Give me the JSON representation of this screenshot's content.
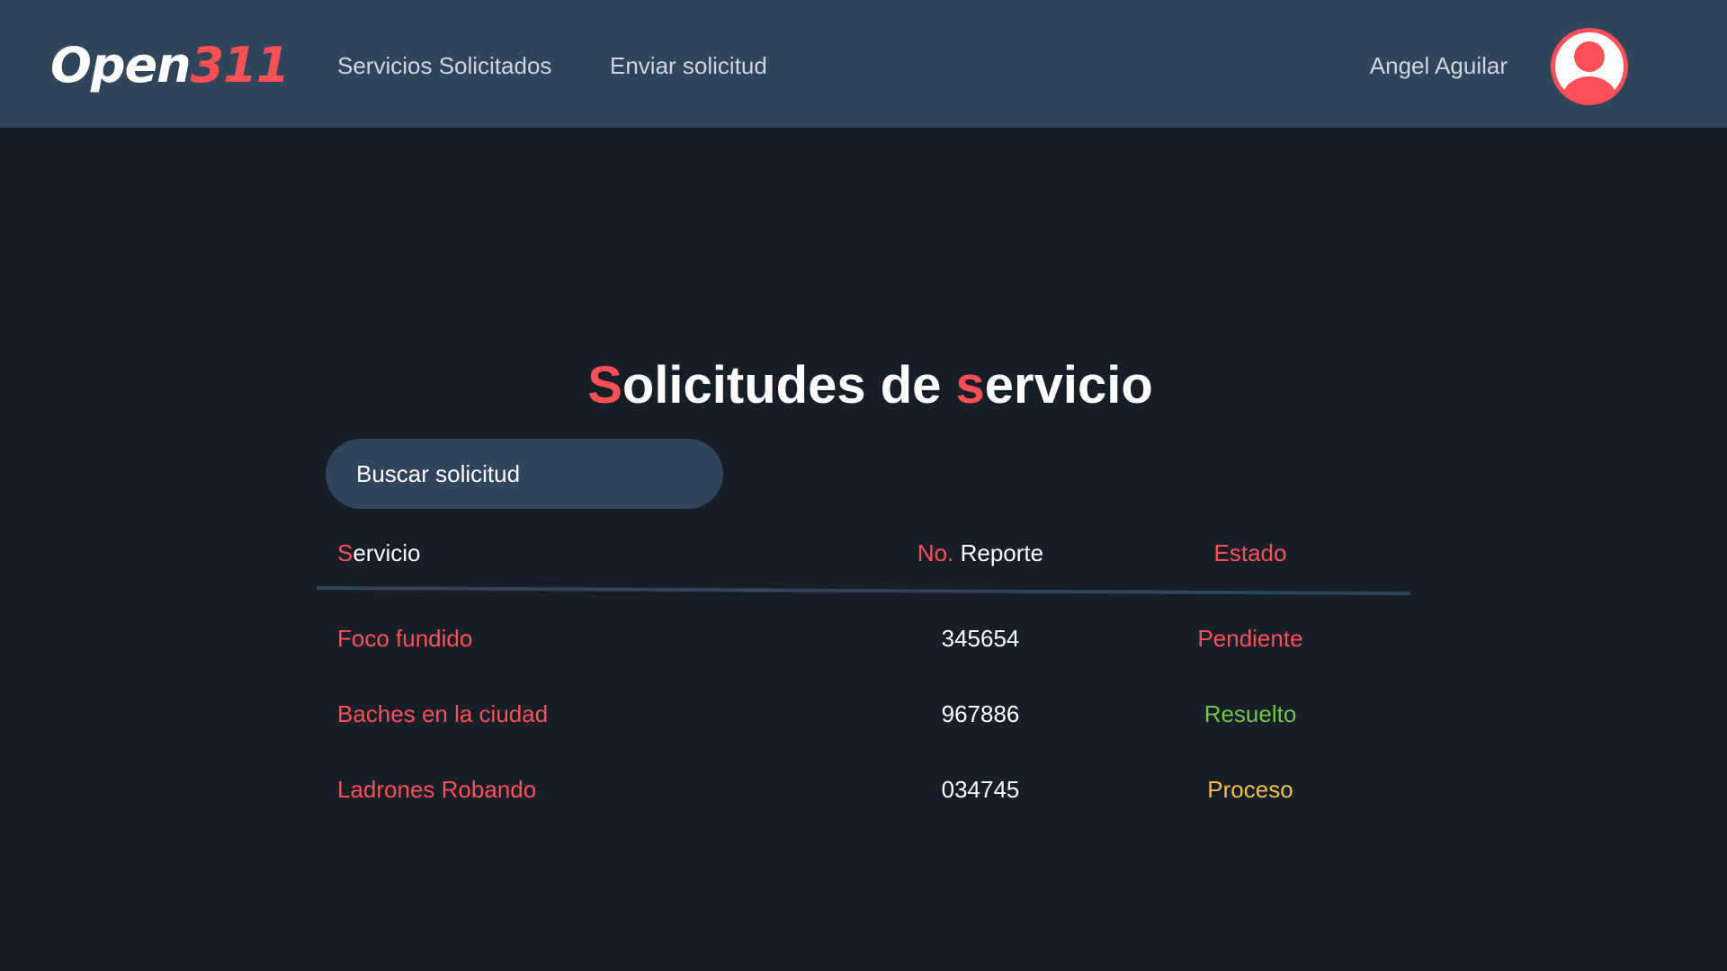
{
  "header": {
    "logo_main": "Open",
    "logo_accent": "311",
    "nav": [
      {
        "label": "Servicios Solicitados"
      },
      {
        "label": "Enviar solicitud"
      }
    ],
    "user_name": "Angel Aguilar",
    "avatar_icon": "user-circle-icon"
  },
  "main": {
    "title_parts": [
      "S",
      "olicitudes de ",
      "s",
      "ervicio"
    ],
    "search_placeholder": "Buscar solicitud",
    "columns": {
      "service": {
        "accent": "S",
        "rest": "ervicio"
      },
      "report": {
        "accent": "No.",
        "rest": " Reporte"
      },
      "status": "Estado"
    },
    "rows": [
      {
        "service": "Foco fundido",
        "report": "345654",
        "status": "Pendiente",
        "status_color": "#ff5057"
      },
      {
        "service": "Baches en la ciudad",
        "report": "967886",
        "status": "Resuelto",
        "status_color": "#74c447"
      },
      {
        "service": "Ladrones Robando",
        "report": "034745",
        "status": "Proceso",
        "status_color": "#f2bd4b"
      }
    ]
  },
  "colors": {
    "accent": "#ff5057",
    "header_bg": "#30445b",
    "page_bg": "#161e28",
    "divider": "#30445b"
  }
}
